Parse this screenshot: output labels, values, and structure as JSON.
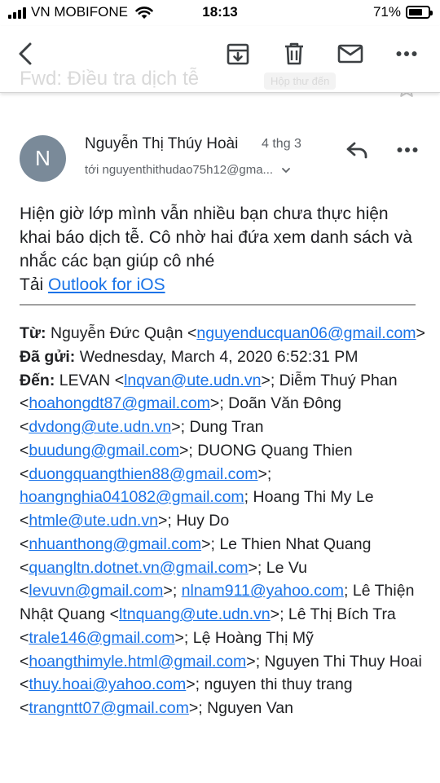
{
  "status_bar": {
    "carrier": "VN MOBIFONE",
    "time": "18:13",
    "battery_percent": "71%",
    "battery_level": 0.71
  },
  "toolbar": {
    "back_icon": "chevron-left-icon",
    "archive_icon": "archive-icon",
    "delete_icon": "trash-icon",
    "mark_unread_icon": "mail-icon",
    "more_icon": "more-horizontal-icon",
    "subject_faded": "Fwd: Điều tra dịch tễ",
    "label_faded": "Hộp thư đến"
  },
  "message": {
    "avatar_letter": "N",
    "sender_name": "Nguyễn Thị Thúy Hoài",
    "date": "4 thg 3",
    "recipient_line": "tới nguyenthithudao75h12@gma...",
    "reply_icon": "reply-icon",
    "more_icon": "more-horizontal-icon",
    "body": "Hiện giờ lớp mình vẫn nhiều bạn chưa thực hiện khai báo dịch tễ. Cô nhờ hai đứa xem danh sách và nhắc các bạn giúp cô nhé",
    "signature_prefix": "Tải",
    "signature_link": "Outlook for iOS"
  },
  "forwarded": {
    "from_label": "Từ:",
    "from_name": "Nguyễn Đức Quận",
    "from_email": "nguyenducquan06@gmail.com",
    "sent_label": "Đã gửi:",
    "sent_value": "Wednesday, March 4, 2020 6:52:31 PM",
    "to_label": "Đến:",
    "to": [
      {
        "name": "LEVAN",
        "email": "lnqvan@ute.udn.vn"
      },
      {
        "name": "Diễm Thuý Phan",
        "email": "hoahongdt87@gmail.com"
      },
      {
        "name": "Doãn Văn Đông",
        "email": "dvdong@ute.udn.vn"
      },
      {
        "name": "Dung Tran",
        "email": "buudung@gmail.com"
      },
      {
        "name": "DUONG Quang Thien",
        "email": "duongquangthien88@gmail.com"
      },
      {
        "name": "",
        "email": "hoangnghia041082@gmail.com"
      },
      {
        "name": "Hoang Thi My Le",
        "email": "htmle@ute.udn.vn"
      },
      {
        "name": "Huy Do",
        "email": "nhuanthong@gmail.com"
      },
      {
        "name": "Le Thien Nhat Quang",
        "email": "quangltn.dotnet.vn@gmail.com"
      },
      {
        "name": "Le Vu",
        "email": "levuvn@gmail.com"
      },
      {
        "name": "",
        "email": "nlnam911@yahoo.com"
      },
      {
        "name": "Lê Thiện Nhật Quang",
        "email": "ltnquang@ute.udn.vn"
      },
      {
        "name": "Lê Thị Bích Tra",
        "email": "trale146@gmail.com"
      },
      {
        "name": "Lệ Hoàng Thị Mỹ",
        "email": "hoangthimyle.html@gmail.com"
      },
      {
        "name": "Nguyen Thi Thuy Hoai",
        "email": "thuy.hoai@yahoo.com"
      },
      {
        "name": "nguyen thi thuy trang",
        "email": "trangntt07@gmail.com"
      },
      {
        "name": "Nguyen Van",
        "email": ""
      }
    ]
  }
}
